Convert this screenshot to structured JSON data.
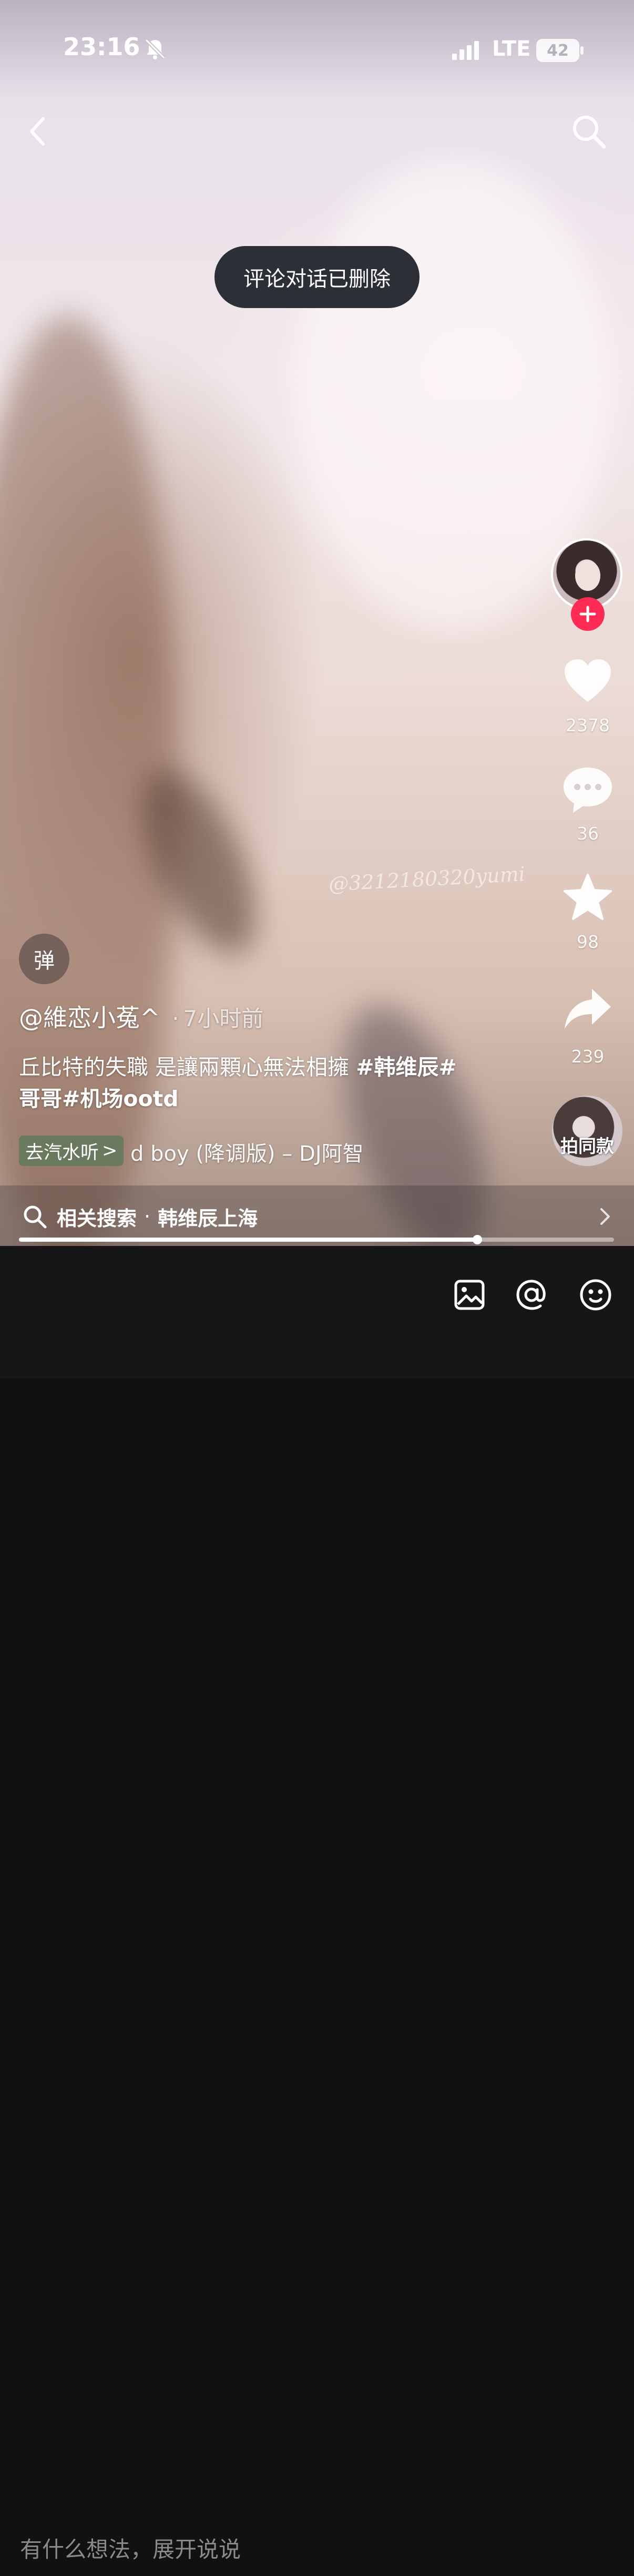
{
  "status_bar": {
    "time": "23:16",
    "network": "LTE",
    "battery": "42",
    "silent_icon": "bell-slash-icon",
    "signal_icon": "signal-bars-icon"
  },
  "top_bar": {
    "back_icon": "back-arrow-icon",
    "search_icon": "search-icon"
  },
  "toast": {
    "text": "评论对话已删除"
  },
  "sidebar": {
    "follow_icon": "plus-icon",
    "like": {
      "icon": "heart-icon",
      "count": "2378"
    },
    "comment": {
      "icon": "comment-bubble-icon",
      "count": "36"
    },
    "favorite": {
      "icon": "star-icon",
      "count": "98"
    },
    "share": {
      "icon": "share-arrow-icon",
      "count": "239"
    },
    "shoot_same": {
      "label": "拍同款"
    }
  },
  "video_watermark": "@3212180320yumi",
  "danmaku": {
    "label": "弹"
  },
  "post": {
    "author": "@維恋小菟^",
    "separator": "·",
    "time": "7小时前",
    "caption_text": "丘比特的失職  是讓兩顆心無法相擁 ",
    "hashtag_1": "#韩维辰#",
    "hashtag_2": "哥哥#机场ootd"
  },
  "music": {
    "tag_label": "去汽水听",
    "tag_chevron": ">",
    "title": "d boy (降调版) – DJ阿智"
  },
  "related_search": {
    "icon": "search-icon",
    "prefix": "相关搜索",
    "separator": "·",
    "query": "韩维辰上海",
    "chevron_icon": "chevron-right-icon"
  },
  "progress": {
    "fraction": 0.77
  },
  "comment_bar": {
    "placeholder": "有什么想法，展开说说",
    "image_icon": "image-icon",
    "mention_icon": "at-icon",
    "emoji_icon": "emoji-icon"
  },
  "colors": {
    "accent_red": "#fe2c55",
    "toast_bg": "#2d2f36",
    "bottom_bar_bg": "#161616"
  }
}
